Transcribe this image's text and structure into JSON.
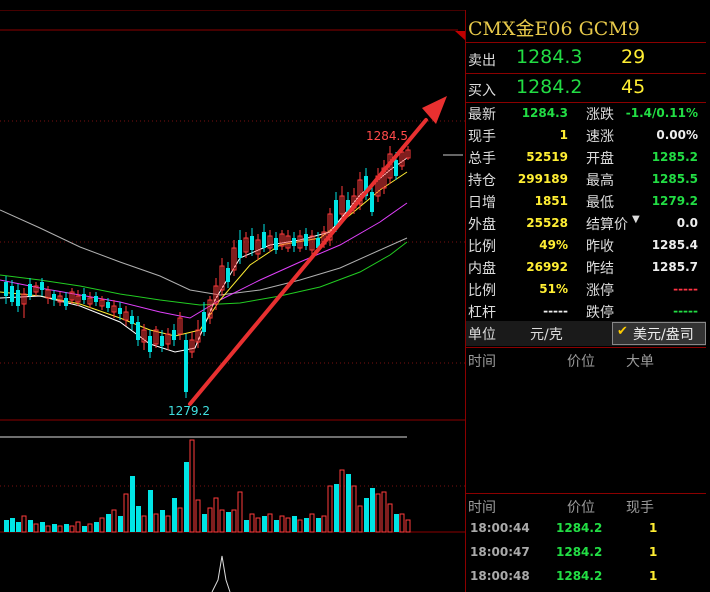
{
  "panel": {
    "title": "CMX金E06  GCM9",
    "sell": {
      "label": "卖出",
      "price": "1284.3",
      "qty": "29"
    },
    "buy": {
      "label": "买入",
      "price": "1284.2",
      "qty": "45"
    },
    "quote_left": [
      {
        "label": "最新",
        "value": "1284.3"
      },
      {
        "label": "现手",
        "value": "1"
      },
      {
        "label": "总手",
        "value": "52519"
      },
      {
        "label": "持仓",
        "value": "299189"
      },
      {
        "label": "日增",
        "value": "1851"
      },
      {
        "label": "外盘",
        "value": "25528"
      },
      {
        "label": "比例",
        "value": "49%"
      },
      {
        "label": "内盘",
        "value": "26992"
      },
      {
        "label": "比例",
        "value": "51%"
      },
      {
        "label": "杠杆",
        "value": "-----"
      }
    ],
    "quote_right": [
      {
        "label": "涨跌",
        "value": "-1.4/0.11%"
      },
      {
        "label": "速涨",
        "value": "0.00%"
      },
      {
        "label": "开盘",
        "value": "1285.2"
      },
      {
        "label": "最高",
        "value": "1285.5"
      },
      {
        "label": "最低",
        "value": "1279.2"
      },
      {
        "label": "结算价",
        "value": "0.0"
      },
      {
        "label": "昨收",
        "value": "1285.4"
      },
      {
        "label": "昨结",
        "value": "1285.7"
      },
      {
        "label": "涨停",
        "value": "-----"
      },
      {
        "label": "跌停",
        "value": "-----"
      }
    ],
    "unit": {
      "label": "单位",
      "value": "元/克",
      "option": "美元/盎司"
    },
    "bigorder_headers": {
      "time": "时间",
      "price": "价位",
      "big": "大单"
    },
    "trades_headers": {
      "time": "时间",
      "price": "价位",
      "qty": "现手"
    },
    "trades": [
      {
        "time": "18:00:44",
        "price": "1284.2",
        "qty": "1"
      },
      {
        "time": "18:00:47",
        "price": "1284.2",
        "qty": "1"
      },
      {
        "time": "18:00:48",
        "price": "1284.2",
        "qty": "1"
      }
    ]
  },
  "chart": {
    "high_label": "1284.5",
    "low_label": "1279.2",
    "colors": {
      "up": "#ff3b3b",
      "down": "#00e5e5",
      "ma5": "#ffffff",
      "ma10": "#ffee33",
      "ma20": "#e040fb",
      "ma60": "#22cc22",
      "ma120": "#b0b0b0",
      "arrow": "#e83030"
    }
  }
}
